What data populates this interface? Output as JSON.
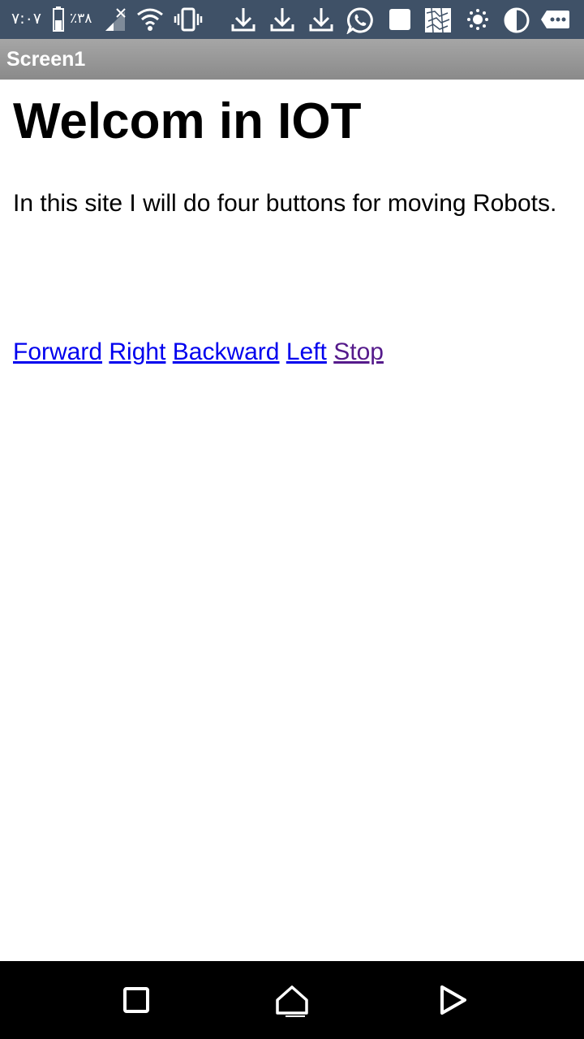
{
  "status_bar": {
    "time": "۷:۰۷",
    "battery_percent": "٪۳۸",
    "icons": [
      "battery-icon",
      "no-signal-icon",
      "wifi-icon",
      "vibrate-icon",
      "download-icon",
      "download-icon",
      "download-icon",
      "whatsapp-icon",
      "square-notification-icon",
      "map-notification-icon",
      "brightness-icon",
      "night-mode-icon",
      "more-notifications-icon"
    ]
  },
  "app_bar": {
    "title": "Screen1"
  },
  "content": {
    "heading": "Welcom in IOT",
    "intro": "In this site I will do four buttons for moving Robots.",
    "links": [
      {
        "label": "Forward",
        "visited": false
      },
      {
        "label": "Right",
        "visited": false
      },
      {
        "label": "Backward",
        "visited": false
      },
      {
        "label": "Left",
        "visited": false
      },
      {
        "label": "Stop",
        "visited": true
      }
    ]
  },
  "nav_bar": {
    "icons": [
      "recents-icon",
      "home-icon",
      "back-icon"
    ]
  },
  "colors": {
    "status_bar": "#3f5167",
    "title_bar": "#999999",
    "link": "#0000ee",
    "visited_link": "#551a8b"
  }
}
